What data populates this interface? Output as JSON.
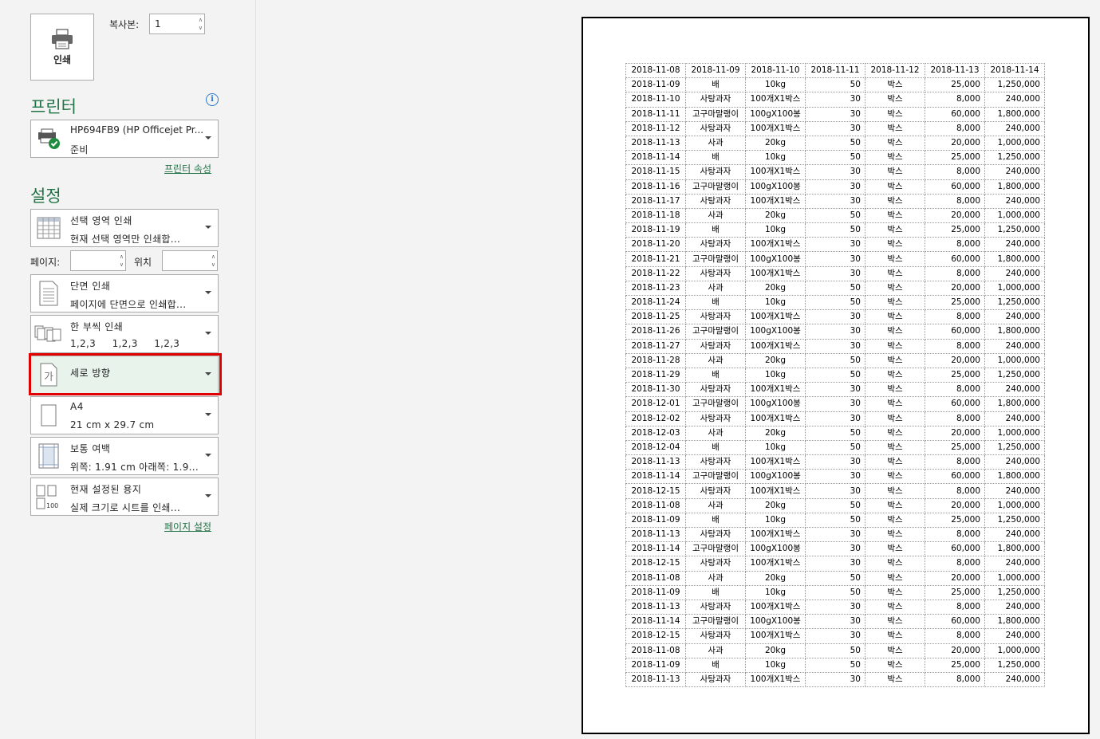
{
  "print": {
    "button_label": "인쇄"
  },
  "copies": {
    "label": "복사본:",
    "value": "1"
  },
  "printer": {
    "section_title": "프린터",
    "name": "HP694FB9 (HP Officejet Pr...",
    "status": "준비",
    "properties_link": "프린터 속성"
  },
  "settings": {
    "section_title": "설정",
    "print_what": {
      "line1": "선택 영역 인쇄",
      "line2": "현재 선택 영역만 인쇄합..."
    },
    "pages_label": "페이지:",
    "to_label": "위치",
    "sides": {
      "line1": "단면 인쇄",
      "line2": "페이지에 단면으로 인쇄합..."
    },
    "collate": {
      "line1": "한 부씩 인쇄",
      "line2": "1,2,3     1,2,3     1,2,3"
    },
    "orientation": {
      "line1": "세로 방향",
      "icon_glyph": "가"
    },
    "paper": {
      "line1": "A4",
      "line2": "21 cm x 29.7 cm"
    },
    "margins": {
      "line1": "보통 여백",
      "line2": "위쪽: 1.91 cm 아래쪽: 1.9..."
    },
    "scaling": {
      "line1": "현재 설정된 용지",
      "line2": "실제 크기로 시트를 인쇄...",
      "icon_text": "100"
    },
    "page_setup_link": "페이지 설정"
  },
  "colors": {
    "accent": "#217346",
    "highlight": "#e00000",
    "selected_bg": "#e8f3ec"
  },
  "sheet": {
    "header": [
      "2018-11-08",
      "2018-11-09",
      "2018-11-10",
      "2018-11-11",
      "2018-11-12",
      "2018-11-13",
      "2018-11-14"
    ],
    "rows": [
      [
        "2018-11-09",
        "배",
        "10kg",
        "50",
        "박스",
        "25,000",
        "1,250,000"
      ],
      [
        "2018-11-10",
        "사탕과자",
        "100개X1박스",
        "30",
        "박스",
        "8,000",
        "240,000"
      ],
      [
        "2018-11-11",
        "고구마말랭이",
        "100gX100봉",
        "30",
        "박스",
        "60,000",
        "1,800,000"
      ],
      [
        "2018-11-12",
        "사탕과자",
        "100개X1박스",
        "30",
        "박스",
        "8,000",
        "240,000"
      ],
      [
        "2018-11-13",
        "사과",
        "20kg",
        "50",
        "박스",
        "20,000",
        "1,000,000"
      ],
      [
        "2018-11-14",
        "배",
        "10kg",
        "50",
        "박스",
        "25,000",
        "1,250,000"
      ],
      [
        "2018-11-15",
        "사탕과자",
        "100개X1박스",
        "30",
        "박스",
        "8,000",
        "240,000"
      ],
      [
        "2018-11-16",
        "고구마말랭이",
        "100gX100봉",
        "30",
        "박스",
        "60,000",
        "1,800,000"
      ],
      [
        "2018-11-17",
        "사탕과자",
        "100개X1박스",
        "30",
        "박스",
        "8,000",
        "240,000"
      ],
      [
        "2018-11-18",
        "사과",
        "20kg",
        "50",
        "박스",
        "20,000",
        "1,000,000"
      ],
      [
        "2018-11-19",
        "배",
        "10kg",
        "50",
        "박스",
        "25,000",
        "1,250,000"
      ],
      [
        "2018-11-20",
        "사탕과자",
        "100개X1박스",
        "30",
        "박스",
        "8,000",
        "240,000"
      ],
      [
        "2018-11-21",
        "고구마말랭이",
        "100gX100봉",
        "30",
        "박스",
        "60,000",
        "1,800,000"
      ],
      [
        "2018-11-22",
        "사탕과자",
        "100개X1박스",
        "30",
        "박스",
        "8,000",
        "240,000"
      ],
      [
        "2018-11-23",
        "사과",
        "20kg",
        "50",
        "박스",
        "20,000",
        "1,000,000"
      ],
      [
        "2018-11-24",
        "배",
        "10kg",
        "50",
        "박스",
        "25,000",
        "1,250,000"
      ],
      [
        "2018-11-25",
        "사탕과자",
        "100개X1박스",
        "30",
        "박스",
        "8,000",
        "240,000"
      ],
      [
        "2018-11-26",
        "고구마말랭이",
        "100gX100봉",
        "30",
        "박스",
        "60,000",
        "1,800,000"
      ],
      [
        "2018-11-27",
        "사탕과자",
        "100개X1박스",
        "30",
        "박스",
        "8,000",
        "240,000"
      ],
      [
        "2018-11-28",
        "사과",
        "20kg",
        "50",
        "박스",
        "20,000",
        "1,000,000"
      ],
      [
        "2018-11-29",
        "배",
        "10kg",
        "50",
        "박스",
        "25,000",
        "1,250,000"
      ],
      [
        "2018-11-30",
        "사탕과자",
        "100개X1박스",
        "30",
        "박스",
        "8,000",
        "240,000"
      ],
      [
        "2018-12-01",
        "고구마말랭이",
        "100gX100봉",
        "30",
        "박스",
        "60,000",
        "1,800,000"
      ],
      [
        "2018-12-02",
        "사탕과자",
        "100개X1박스",
        "30",
        "박스",
        "8,000",
        "240,000"
      ],
      [
        "2018-12-03",
        "사과",
        "20kg",
        "50",
        "박스",
        "20,000",
        "1,000,000"
      ],
      [
        "2018-12-04",
        "배",
        "10kg",
        "50",
        "박스",
        "25,000",
        "1,250,000"
      ],
      [
        "2018-11-13",
        "사탕과자",
        "100개X1박스",
        "30",
        "박스",
        "8,000",
        "240,000"
      ],
      [
        "2018-11-14",
        "고구마말랭이",
        "100gX100봉",
        "30",
        "박스",
        "60,000",
        "1,800,000"
      ],
      [
        "2018-12-15",
        "사탕과자",
        "100개X1박스",
        "30",
        "박스",
        "8,000",
        "240,000"
      ],
      [
        "2018-11-08",
        "사과",
        "20kg",
        "50",
        "박스",
        "20,000",
        "1,000,000"
      ],
      [
        "2018-11-09",
        "배",
        "10kg",
        "50",
        "박스",
        "25,000",
        "1,250,000"
      ],
      [
        "2018-11-13",
        "사탕과자",
        "100개X1박스",
        "30",
        "박스",
        "8,000",
        "240,000"
      ],
      [
        "2018-11-14",
        "고구마말랭이",
        "100gX100봉",
        "30",
        "박스",
        "60,000",
        "1,800,000"
      ],
      [
        "2018-12-15",
        "사탕과자",
        "100개X1박스",
        "30",
        "박스",
        "8,000",
        "240,000"
      ],
      [
        "2018-11-08",
        "사과",
        "20kg",
        "50",
        "박스",
        "20,000",
        "1,000,000"
      ],
      [
        "2018-11-09",
        "배",
        "10kg",
        "50",
        "박스",
        "25,000",
        "1,250,000"
      ],
      [
        "2018-11-13",
        "사탕과자",
        "100개X1박스",
        "30",
        "박스",
        "8,000",
        "240,000"
      ],
      [
        "2018-11-14",
        "고구마말랭이",
        "100gX100봉",
        "30",
        "박스",
        "60,000",
        "1,800,000"
      ],
      [
        "2018-12-15",
        "사탕과자",
        "100개X1박스",
        "30",
        "박스",
        "8,000",
        "240,000"
      ],
      [
        "2018-11-08",
        "사과",
        "20kg",
        "50",
        "박스",
        "20,000",
        "1,000,000"
      ],
      [
        "2018-11-09",
        "배",
        "10kg",
        "50",
        "박스",
        "25,000",
        "1,250,000"
      ],
      [
        "2018-11-13",
        "사탕과자",
        "100개X1박스",
        "30",
        "박스",
        "8,000",
        "240,000"
      ]
    ]
  }
}
